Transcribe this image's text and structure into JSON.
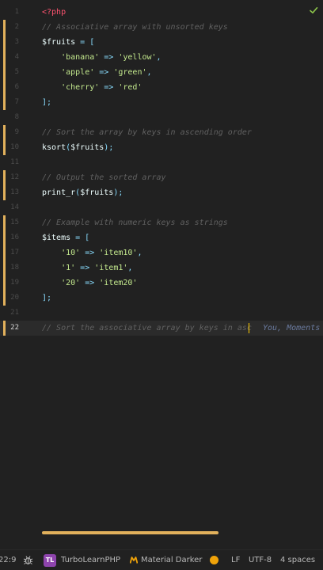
{
  "editor": {
    "current_line": 22,
    "lines": [
      {
        "n": "1",
        "tokens": [
          {
            "t": "<?php",
            "c": "tag"
          }
        ]
      },
      {
        "n": "2",
        "tokens": [
          {
            "t": "// Associative array with unsorted keys",
            "c": "comment"
          }
        ]
      },
      {
        "n": "3",
        "tokens": [
          {
            "t": "$fruits",
            "c": "var"
          },
          {
            "t": " = [",
            "c": "punc"
          }
        ]
      },
      {
        "n": "4",
        "tokens": [
          {
            "t": "    ",
            "c": "var"
          },
          {
            "t": "'banana'",
            "c": "str"
          },
          {
            "t": " => ",
            "c": "punc"
          },
          {
            "t": "'yellow'",
            "c": "str"
          },
          {
            "t": ",",
            "c": "punc"
          }
        ]
      },
      {
        "n": "5",
        "tokens": [
          {
            "t": "    ",
            "c": "var"
          },
          {
            "t": "'apple'",
            "c": "str"
          },
          {
            "t": " => ",
            "c": "punc"
          },
          {
            "t": "'green'",
            "c": "str"
          },
          {
            "t": ",",
            "c": "punc"
          }
        ]
      },
      {
        "n": "6",
        "tokens": [
          {
            "t": "    ",
            "c": "var"
          },
          {
            "t": "'cherry'",
            "c": "str"
          },
          {
            "t": " => ",
            "c": "punc"
          },
          {
            "t": "'red'",
            "c": "str"
          }
        ]
      },
      {
        "n": "7",
        "tokens": [
          {
            "t": "];",
            "c": "punc"
          }
        ]
      },
      {
        "n": "8",
        "tokens": []
      },
      {
        "n": "9",
        "tokens": [
          {
            "t": "// Sort the array by keys in ascending order",
            "c": "comment"
          }
        ]
      },
      {
        "n": "10",
        "tokens": [
          {
            "t": "ksort",
            "c": "func"
          },
          {
            "t": "(",
            "c": "punc"
          },
          {
            "t": "$fruits",
            "c": "var"
          },
          {
            "t": ");",
            "c": "punc"
          }
        ]
      },
      {
        "n": "11",
        "tokens": []
      },
      {
        "n": "12",
        "tokens": [
          {
            "t": "// Output the sorted array",
            "c": "comment"
          }
        ]
      },
      {
        "n": "13",
        "tokens": [
          {
            "t": "print_r",
            "c": "func"
          },
          {
            "t": "(",
            "c": "punc"
          },
          {
            "t": "$fruits",
            "c": "var"
          },
          {
            "t": ");",
            "c": "punc"
          }
        ]
      },
      {
        "n": "14",
        "tokens": []
      },
      {
        "n": "15",
        "tokens": [
          {
            "t": "// Example with numeric keys as strings",
            "c": "comment"
          }
        ]
      },
      {
        "n": "16",
        "tokens": [
          {
            "t": "$items",
            "c": "var"
          },
          {
            "t": " = [",
            "c": "punc"
          }
        ]
      },
      {
        "n": "17",
        "tokens": [
          {
            "t": "    ",
            "c": "var"
          },
          {
            "t": "'10'",
            "c": "str"
          },
          {
            "t": " => ",
            "c": "punc"
          },
          {
            "t": "'item10'",
            "c": "str"
          },
          {
            "t": ",",
            "c": "punc"
          }
        ]
      },
      {
        "n": "18",
        "tokens": [
          {
            "t": "    ",
            "c": "var"
          },
          {
            "t": "'1'",
            "c": "str"
          },
          {
            "t": " => ",
            "c": "punc"
          },
          {
            "t": "'item1'",
            "c": "str"
          },
          {
            "t": ",",
            "c": "punc"
          }
        ]
      },
      {
        "n": "19",
        "tokens": [
          {
            "t": "    ",
            "c": "var"
          },
          {
            "t": "'20'",
            "c": "str"
          },
          {
            "t": " => ",
            "c": "punc"
          },
          {
            "t": "'item20'",
            "c": "str"
          }
        ]
      },
      {
        "n": "20",
        "tokens": [
          {
            "t": "];",
            "c": "punc"
          }
        ]
      },
      {
        "n": "21",
        "tokens": []
      },
      {
        "n": "22",
        "tokens": [
          {
            "t": "// Sort the associative array by keys in asc",
            "c": "comment"
          }
        ]
      }
    ],
    "modified_lines": [
      2,
      3,
      4,
      5,
      6,
      7,
      9,
      10,
      12,
      13,
      15,
      16,
      17,
      18,
      19,
      20,
      22
    ],
    "inline_blame": "You, Moments",
    "status_icon": "check-icon",
    "check_color": "#8bc34a",
    "modified_color": "#e2b15c"
  },
  "status_bar": {
    "cursor_position": "22:9",
    "debug_icon": "bug-icon",
    "plugin_badge": "TL",
    "plugin_name": "TurboLearnPHP",
    "theme_icon": "material-theme-icon",
    "theme_name": "Material Darker",
    "indicator_color": "#f0a30a",
    "line_ending": "LF",
    "encoding": "UTF-8",
    "indent": "4 spaces"
  }
}
